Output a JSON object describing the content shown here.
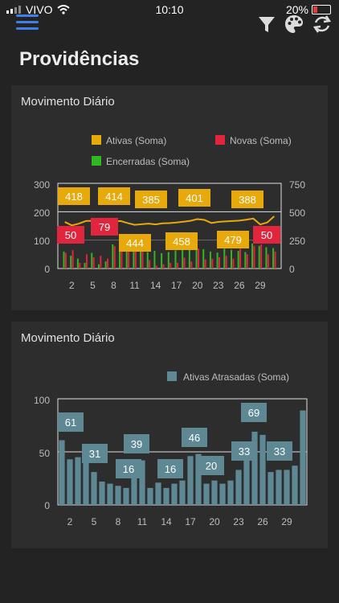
{
  "status_bar": {
    "carrier": "VIVO",
    "time": "10:10",
    "battery": "20%"
  },
  "toolbar": {
    "menu_icon": "hamburger-menu-icon",
    "filter_icon": "filter-funnel-icon",
    "palette_icon": "palette-icon",
    "refresh_icon": "refresh-icon",
    "accent": "#3f7fe6"
  },
  "page": {
    "title": "Providências"
  },
  "charts": [
    {
      "title": "Movimento Diário"
    },
    {
      "title": "Movimento Diário"
    }
  ],
  "chart_data": [
    {
      "type": "bar",
      "title": "Movimento Diário",
      "x_tick_labels": [
        "2",
        "5",
        "8",
        "11",
        "14",
        "17",
        "20",
        "23",
        "26",
        "29"
      ],
      "y_left_ticks": [
        "300",
        "200",
        "100",
        "0"
      ],
      "y_right_ticks": [
        "750",
        "500",
        "250",
        "0"
      ],
      "ylim_left": [
        0,
        300
      ],
      "ylim_right": [
        0,
        750
      ],
      "legend": [
        "Ativas (Soma)",
        "Novas (Soma)",
        "Encerradas (Soma)"
      ],
      "legend_placement": "top",
      "colors": {
        "Ativas (Soma)": "#e8a90c",
        "Novas (Soma)": "#e0253c",
        "Encerradas (Soma)": "#34b524"
      },
      "days": [
        1,
        2,
        3,
        4,
        5,
        6,
        7,
        8,
        9,
        10,
        11,
        12,
        13,
        14,
        15,
        16,
        17,
        18,
        19,
        20,
        21,
        22,
        23,
        24,
        25,
        26,
        27,
        28,
        29,
        30,
        31
      ],
      "series": [
        {
          "name": "Ativas (Soma)",
          "axis": "right",
          "values": [
            410,
            380,
            395,
            418,
            420,
            415,
            412,
            414,
            418,
            400,
            385,
            390,
            395,
            388,
            398,
            400,
            405,
            412,
            420,
            435,
            428,
            401,
            410,
            415,
            418,
            422,
            430,
            440,
            388,
            405,
            460
          ]
        },
        {
          "name": "Novas (Soma)",
          "axis": "left",
          "values": [
            55,
            65,
            20,
            50,
            40,
            45,
            35,
            79,
            85,
            70,
            60,
            72,
            30,
            10,
            15,
            20,
            20,
            38,
            25,
            70,
            32,
            35,
            40,
            45,
            35,
            70,
            50,
            80,
            85,
            50,
            60
          ]
        },
        {
          "name": "Encerradas (Soma)",
          "axis": "left",
          "values": [
            60,
            45,
            35,
            20,
            55,
            15,
            25,
            85,
            80,
            88,
            75,
            68,
            58,
            62,
            54,
            58,
            64,
            72,
            66,
            75,
            68,
            60,
            56,
            70,
            66,
            62,
            58,
            88,
            80,
            75,
            72
          ]
        }
      ],
      "data_labels": [
        {
          "series": "Ativas (Soma)",
          "text": "418"
        },
        {
          "series": "Ativas (Soma)",
          "text": "414"
        },
        {
          "series": "Ativas (Soma)",
          "text": "385"
        },
        {
          "series": "Ativas (Soma)",
          "text": "401"
        },
        {
          "series": "Ativas (Soma)",
          "text": "388"
        },
        {
          "series": "Ativas (Soma)",
          "text": "444"
        },
        {
          "series": "Ativas (Soma)",
          "text": "458"
        },
        {
          "series": "Ativas (Soma)",
          "text": "479"
        },
        {
          "series": "Novas (Soma)",
          "text": "50"
        },
        {
          "series": "Novas (Soma)",
          "text": "79"
        },
        {
          "series": "Novas (Soma)",
          "text": "50"
        }
      ]
    },
    {
      "type": "bar",
      "title": "Movimento Diário",
      "x_tick_labels": [
        "2",
        "5",
        "8",
        "11",
        "14",
        "17",
        "20",
        "23",
        "26",
        "29"
      ],
      "y_ticks": [
        "100",
        "50",
        "0"
      ],
      "ylim": [
        0,
        100
      ],
      "legend": [
        "Ativas Atrasadas (Soma)"
      ],
      "legend_placement": "top-right",
      "colors": {
        "Ativas Atrasadas (Soma)": "#5d8894"
      },
      "days": [
        1,
        2,
        3,
        4,
        5,
        6,
        7,
        8,
        9,
        10,
        11,
        12,
        13,
        14,
        15,
        16,
        17,
        18,
        19,
        20,
        21,
        22,
        23,
        24,
        25,
        26,
        27,
        28,
        29,
        30,
        31
      ],
      "series": [
        {
          "name": "Ativas Atrasadas (Soma)",
          "values": [
            61,
            43,
            45,
            48,
            31,
            22,
            20,
            18,
            16,
            39,
            42,
            16,
            21,
            16,
            20,
            23,
            46,
            48,
            20,
            23,
            20,
            23,
            33,
            51,
            69,
            66,
            31,
            33,
            33,
            37,
            89
          ]
        }
      ],
      "data_labels": [
        {
          "text": "61"
        },
        {
          "text": "31"
        },
        {
          "text": "39"
        },
        {
          "text": "16"
        },
        {
          "text": "16"
        },
        {
          "text": "46"
        },
        {
          "text": "20"
        },
        {
          "text": "69"
        },
        {
          "text": "33"
        },
        {
          "text": "33"
        }
      ]
    }
  ]
}
